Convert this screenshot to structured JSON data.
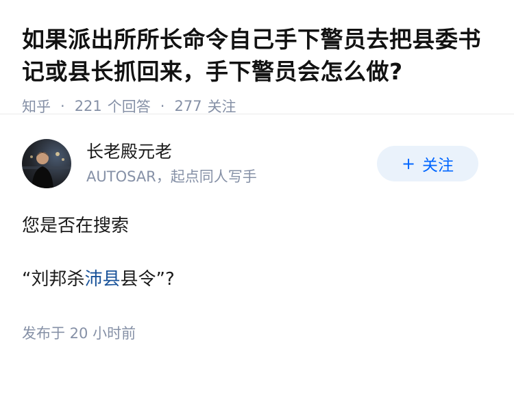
{
  "question": {
    "title": "如果派出所所长命令自己手下警员去把县委书记或县长抓回来，手下警员会怎么做?",
    "source": "知乎",
    "answers_count": "221",
    "answers_label": "个回答",
    "follow_count": "277",
    "follow_label": "关注"
  },
  "answer": {
    "author_name": "长老殿元老",
    "author_bio": "AUTOSAR，起点同人写手",
    "follow_button": "关注",
    "paragraph1": "您是否在搜索",
    "quote_open": "“刘邦杀",
    "link_text": "沛县",
    "quote_close": "县令”?",
    "published": "发布于  20 小时前"
  },
  "colors": {
    "link": "#175199",
    "meta": "#8590a6",
    "follow_bg": "#eaf2fb",
    "follow_text": "#0066ff"
  },
  "icons": {
    "follow": "plus-icon"
  }
}
